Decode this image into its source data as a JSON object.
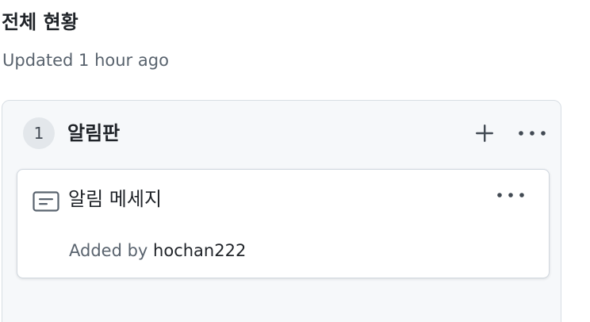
{
  "project": {
    "title": "전체 현황",
    "updated": "Updated 1 hour ago"
  },
  "column": {
    "count": "1",
    "title": "알림판",
    "add_icon": "plus-icon",
    "more_icon": "kebab-horizontal-icon"
  },
  "card": {
    "icon": "note-icon",
    "title": "알림 메세지",
    "added_label": "Added by",
    "added_user": "hochan222",
    "more_icon": "kebab-horizontal-icon"
  },
  "colors": {
    "text_primary": "#1f2328",
    "text_muted": "#59636e",
    "column_bg": "#f6f8fa",
    "badge_bg": "#e3e7eb",
    "border": "#d0d7de"
  }
}
